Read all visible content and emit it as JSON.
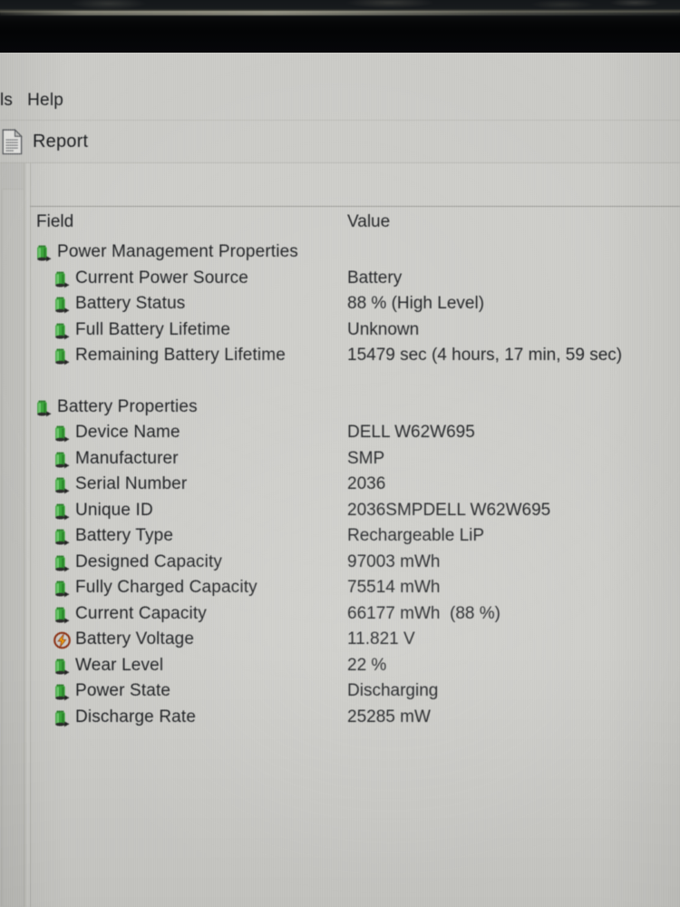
{
  "window": {
    "menu": [
      "ls",
      "Help"
    ],
    "toolbar": {
      "report_label": "Report",
      "report_icon": "document-icon"
    }
  },
  "columns": {
    "field": "Field",
    "value": "Value"
  },
  "colors": {
    "battery_icon_green": "#3aa83a",
    "voltage_icon_orange": "#f0a30a",
    "voltage_icon_ring": "#8c2f12",
    "window_bg": "#cbcbc7",
    "grid_bg": "#cdcdc9",
    "text": "#1d1f22",
    "bezel": "#060708"
  },
  "groups": [
    {
      "header": {
        "label": "Power Management Properties",
        "icon": "battery-icon",
        "value": ""
      },
      "rows": [
        {
          "label": "Current Power Source",
          "icon": "battery-icon",
          "value": "Battery"
        },
        {
          "label": "Battery Status",
          "icon": "battery-icon",
          "value": "88 % (High Level)"
        },
        {
          "label": "Full Battery Lifetime",
          "icon": "battery-icon",
          "value": "Unknown"
        },
        {
          "label": "Remaining Battery Lifetime",
          "icon": "battery-icon",
          "value": "15479 sec (4 hours, 17 min, 59 sec)"
        }
      ]
    },
    {
      "header": {
        "label": "Battery Properties",
        "icon": "battery-icon",
        "value": ""
      },
      "rows": [
        {
          "label": "Device Name",
          "icon": "battery-icon",
          "value": "DELL W62W695"
        },
        {
          "label": "Manufacturer",
          "icon": "battery-icon",
          "value": "SMP"
        },
        {
          "label": "Serial Number",
          "icon": "battery-icon",
          "value": "2036"
        },
        {
          "label": "Unique ID",
          "icon": "battery-icon",
          "value": "2036SMPDELL W62W695"
        },
        {
          "label": "Battery Type",
          "icon": "battery-icon",
          "value": "Rechargeable LiP"
        },
        {
          "label": "Designed Capacity",
          "icon": "battery-icon",
          "value": "97003 mWh"
        },
        {
          "label": "Fully Charged Capacity",
          "icon": "battery-icon",
          "value": "75514 mWh"
        },
        {
          "label": "Current Capacity",
          "icon": "battery-icon",
          "value": "66177 mWh  (88 %)"
        },
        {
          "label": "Battery Voltage",
          "icon": "voltage-icon",
          "value": "11.821 V"
        },
        {
          "label": "Wear Level",
          "icon": "battery-icon",
          "value": "22 %"
        },
        {
          "label": "Power State",
          "icon": "battery-icon",
          "value": "Discharging"
        },
        {
          "label": "Discharge Rate",
          "icon": "battery-icon",
          "value": "25285 mW"
        }
      ]
    }
  ]
}
